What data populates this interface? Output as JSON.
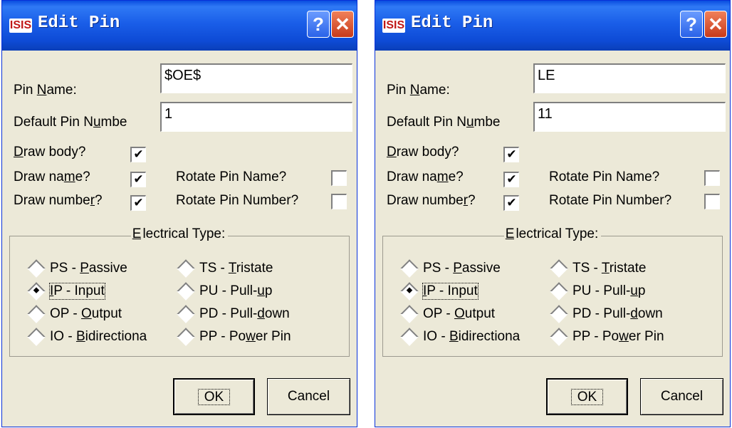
{
  "dialogs": [
    {
      "title": "Edit Pin",
      "logo": "ISIS",
      "help_glyph": "?",
      "close_glyph": "✕",
      "pin_name_label": [
        "Pin ",
        "N",
        "ame:"
      ],
      "pin_name_value": "$OE$",
      "pin_number_label": [
        "Default Pin N",
        "u",
        "mbe"
      ],
      "pin_number_value": "1",
      "draw_body": [
        "",
        "D",
        "raw body?"
      ],
      "draw_name": [
        "Draw na",
        "m",
        "e?"
      ],
      "draw_number": [
        "Draw numbe",
        "r",
        "?"
      ],
      "rotate_name": "Rotate Pin Name?",
      "rotate_number": "Rotate Pin Number?",
      "electrical_type": [
        "",
        "E",
        "lectrical Type:"
      ],
      "types": {
        "ps": [
          "PS - ",
          "P",
          "assive"
        ],
        "ts": [
          "TS - ",
          "T",
          "ristate"
        ],
        "ip": [
          "",
          "I",
          "P - Input"
        ],
        "pu": [
          "PU - Pull-",
          "u",
          "p"
        ],
        "op": [
          "OP - ",
          "O",
          "utput"
        ],
        "pd": [
          "PD - Pull-",
          "d",
          "own"
        ],
        "io": [
          "IO - ",
          "B",
          "idirectiona"
        ],
        "pp": [
          "PP - Po",
          "w",
          "er Pin"
        ]
      },
      "ok": "OK",
      "cancel": "Cancel"
    },
    {
      "title": "Edit Pin",
      "logo": "ISIS",
      "help_glyph": "?",
      "close_glyph": "✕",
      "pin_name_label": [
        "Pin ",
        "N",
        "ame:"
      ],
      "pin_name_value": "LE",
      "pin_number_label": [
        "Default Pin N",
        "u",
        "mbe"
      ],
      "pin_number_value": "11",
      "draw_body": [
        "",
        "D",
        "raw body?"
      ],
      "draw_name": [
        "Draw na",
        "m",
        "e?"
      ],
      "draw_number": [
        "Draw numbe",
        "r",
        "?"
      ],
      "rotate_name": "Rotate Pin Name?",
      "rotate_number": "Rotate Pin Number?",
      "electrical_type": [
        "",
        "E",
        "lectrical Type:"
      ],
      "types": {
        "ps": [
          "PS - ",
          "P",
          "assive"
        ],
        "ts": [
          "TS - ",
          "T",
          "ristate"
        ],
        "ip": [
          "",
          "I",
          "P - Input"
        ],
        "pu": [
          "PU - Pull-",
          "u",
          "p"
        ],
        "op": [
          "OP - ",
          "O",
          "utput"
        ],
        "pd": [
          "PD - Pull-",
          "d",
          "own"
        ],
        "io": [
          "IO - ",
          "B",
          "idirectiona"
        ],
        "pp": [
          "PP - Po",
          "w",
          "er Pin"
        ]
      },
      "ok": "OK",
      "cancel": "Cancel"
    }
  ],
  "check_glyph": "✔",
  "colors": {
    "titlebar": "#0a4de0",
    "dialog_bg": "#ece9d8",
    "close": "#c83a1a"
  },
  "icons": {
    "help": "question-mark-icon",
    "close": "close-icon",
    "app": "isis-logo-icon"
  }
}
